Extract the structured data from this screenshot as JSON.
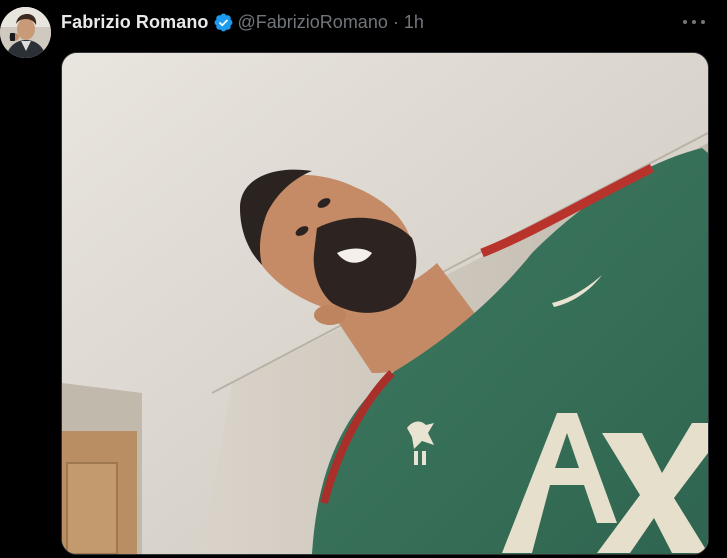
{
  "tweet": {
    "author": {
      "display_name": "Fabrizio Romano",
      "handle": "@FabrizioRomano",
      "verified": true,
      "avatar": "profile-photo"
    },
    "separator": "·",
    "time": "1h",
    "more_icon": "more-horizontal-icon",
    "media": {
      "kind": "photo",
      "shirt_lettering": "AXA"
    }
  },
  "colors": {
    "background": "#000000",
    "name_text": "#e7e9ea",
    "secondary_text": "#71767b",
    "verified_blue": "#1d9bf0",
    "media_border": "#2f3336"
  }
}
